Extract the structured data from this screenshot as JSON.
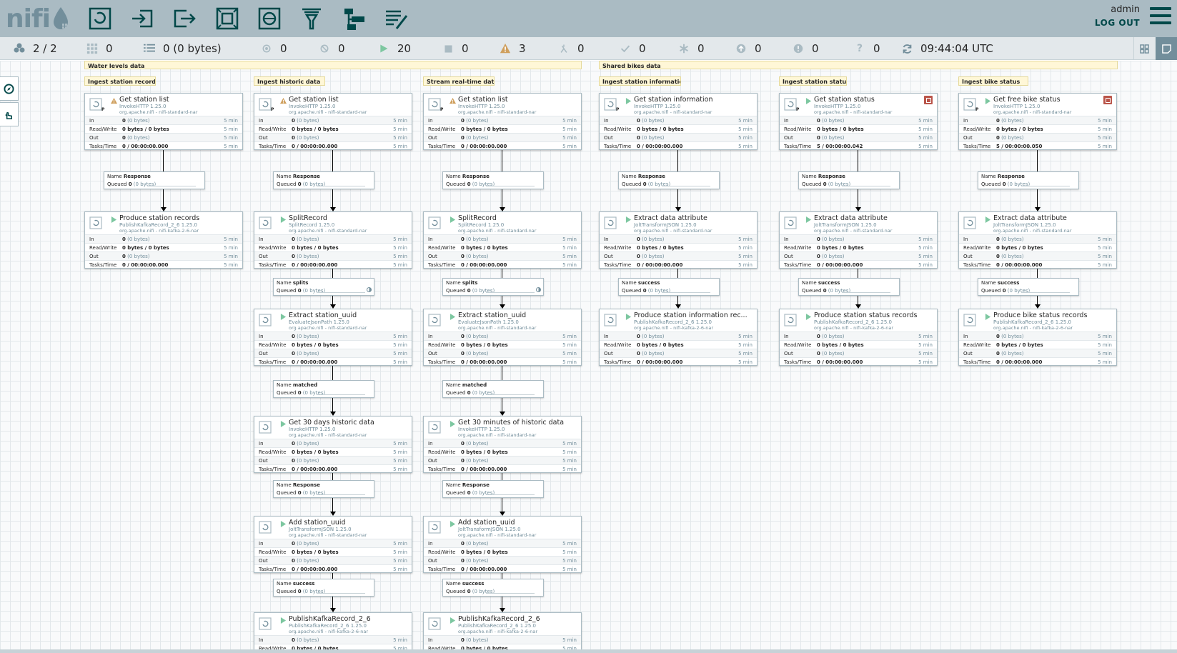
{
  "header": {
    "logo_text": "nifi",
    "toolbar_items": [
      "processor-icon",
      "input-port-icon",
      "output-port-icon",
      "process-group-icon",
      "remote-process-group-icon",
      "funnel-icon",
      "template-icon",
      "label-icon"
    ],
    "user": "admin",
    "logout": "LOG OUT"
  },
  "status": {
    "cluster": "2 / 2",
    "threads": "0",
    "queued": "0 (0 bytes)",
    "transmitting": "0",
    "not_transmitting": "0",
    "running": "20",
    "stopped": "0",
    "invalid": "3",
    "disabled": "0",
    "up_to_date": "0",
    "locally_modified": "0",
    "stale": "0",
    "locally_modified_stale": "0",
    "sync_failure": "0",
    "refresh_time": "09:44:04 UTC"
  },
  "colors": {
    "header_bg": "#aabbc3",
    "accent": "#004849",
    "running": "#7dc7a0",
    "invalid": "#cf9f5d",
    "stopped_badge": "#ba554a",
    "label_bg": "#fff7d7"
  },
  "labels": {
    "water": "Water levels data",
    "bikes": "Shared bikes data",
    "ingest_station_records": "Ingest station records",
    "ingest_historic": "Ingest historic data",
    "stream_realtime": "Stream real-time data",
    "ingest_station_info": "Ingest station information",
    "ingest_station_status": "Ingest station status",
    "ingest_bike_status": "Ingest bike status"
  },
  "stat_labels": {
    "in": "In",
    "rw": "Read/Write",
    "out": "Out",
    "tasks": "Tasks/Time",
    "in_val": "0",
    "in_bytes": "(0 bytes)",
    "rw_val": "0 bytes / 0 bytes",
    "out_val": "0",
    "out_bytes": "(0 bytes)",
    "tasks_val": "0 / 00:00:00.000",
    "tasks_val_status": "5 / 00:00:00.042",
    "tasks_val_bike": "5 / 00:00:00.050",
    "window": "5 min"
  },
  "processors": {
    "c1_get": {
      "name": "Get station list",
      "type": "InvokeHTTP 1.25.0",
      "bundle": "org.apache.nifi - nifi-standard-nar"
    },
    "c1_produce": {
      "name": "Produce station records",
      "type": "PublishKafkaRecord_2_6 1.25.0",
      "bundle": "org.apache.nifi - nifi-kafka-2-6-nar"
    },
    "c2_get": {
      "name": "Get station list",
      "type": "InvokeHTTP 1.25.0",
      "bundle": "org.apache.nifi - nifi-standard-nar"
    },
    "c2_split": {
      "name": "SplitRecord",
      "type": "SplitRecord 1.25.0",
      "bundle": "org.apache.nifi - nifi-standard-nar"
    },
    "c2_extract": {
      "name": "Extract station_uuid",
      "type": "EvaluateJsonPath 1.25.0",
      "bundle": "org.apache.nifi - nifi-standard-nar"
    },
    "c2_hist": {
      "name": "Get 30 days historic data",
      "type": "InvokeHTTP 1.25.0",
      "bundle": "org.apache.nifi - nifi-standard-nar"
    },
    "c2_add": {
      "name": "Add station_uuid",
      "type": "JoltTransformJSON 1.25.0",
      "bundle": "org.apache.nifi - nifi-standard-nar"
    },
    "c2_pub": {
      "name": "PublishKafkaRecord_2_6",
      "type": "PublishKafkaRecord_2_6 1.25.0",
      "bundle": "org.apache.nifi - nifi-kafka-2-6-nar"
    },
    "c3_get": {
      "name": "Get station list",
      "type": "InvokeHTTP 1.25.0",
      "bundle": "org.apache.nifi - nifi-standard-nar"
    },
    "c3_split": {
      "name": "SplitRecord",
      "type": "SplitRecord 1.25.0",
      "bundle": "org.apache.nifi - nifi-standard-nar"
    },
    "c3_extract": {
      "name": "Extract station_uuid",
      "type": "EvaluateJsonPath 1.25.0",
      "bundle": "org.apache.nifi - nifi-standard-nar"
    },
    "c3_hist": {
      "name": "Get 30 minutes of historic data",
      "type": "InvokeHTTP 1.25.0",
      "bundle": "org.apache.nifi - nifi-standard-nar"
    },
    "c3_add": {
      "name": "Add station_uuid",
      "type": "JoltTransformJSON 1.25.0",
      "bundle": "org.apache.nifi - nifi-standard-nar"
    },
    "c3_pub": {
      "name": "PublishKafkaRecord_2_6",
      "type": "PublishKafkaRecord_2_6 1.25.0",
      "bundle": "org.apache.nifi - nifi-kafka-2-6-nar"
    },
    "c4_get": {
      "name": "Get station information",
      "type": "InvokeHTTP 1.25.0",
      "bundle": "org.apache.nifi - nifi-standard-nar"
    },
    "c4_extract": {
      "name": "Extract data attribute",
      "type": "JoltTransformJSON 1.25.0",
      "bundle": "org.apache.nifi - nifi-standard-nar"
    },
    "c4_produce": {
      "name": "Produce station information rec...",
      "type": "PublishKafkaRecord_2_6 1.25.0",
      "bundle": "org.apache.nifi - nifi-kafka-2-6-nar"
    },
    "c5_get": {
      "name": "Get station status",
      "type": "InvokeHTTP 1.25.0",
      "bundle": "org.apache.nifi - nifi-standard-nar"
    },
    "c5_extract": {
      "name": "Extract data attribute",
      "type": "JoltTransformJSON 1.25.0",
      "bundle": "org.apache.nifi - nifi-standard-nar"
    },
    "c5_produce": {
      "name": "Produce station status records",
      "type": "PublishKafkaRecord_2_6 1.25.0",
      "bundle": "org.apache.nifi - nifi-kafka-2-6-nar"
    },
    "c6_get": {
      "name": "Get free bike status",
      "type": "InvokeHTTP 1.25.0",
      "bundle": "org.apache.nifi - nifi-standard-nar"
    },
    "c6_extract": {
      "name": "Extract data attribute",
      "type": "JoltTransformJSON 1.25.0",
      "bundle": "org.apache.nifi - nifi-standard-nar"
    },
    "c6_produce": {
      "name": "Produce bike status records",
      "type": "PublishKafkaRecord_2_6 1.25.0",
      "bundle": "org.apache.nifi - nifi-kafka-2-6-nar"
    }
  },
  "connections": {
    "name_label": "Name",
    "queued_label": "Queued",
    "queued_count": "0",
    "queued_bytes": "(0 bytes)",
    "response": "Response",
    "splits": "splits",
    "matched": "matched",
    "success": "success"
  }
}
